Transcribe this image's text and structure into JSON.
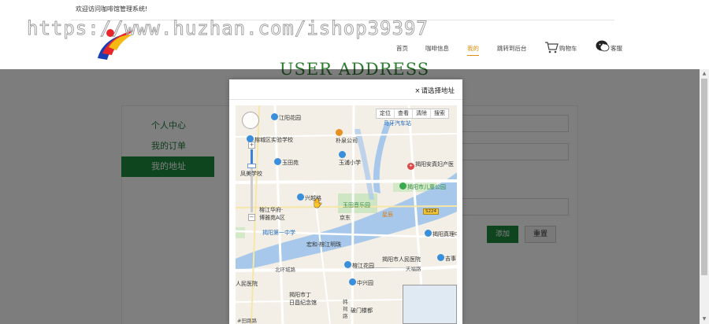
{
  "header": {
    "welcome_text": "欢迎访问咖啡馆管理系统!",
    "watermark": "https://www.huzhan.com/ishop39397",
    "nav": [
      "首页",
      "咖啡信息",
      "我的",
      "跳转到后台",
      "购物车",
      "客服"
    ],
    "active_nav_index": 2
  },
  "page": {
    "heading": "USER ADDRESS",
    "sidebar": [
      "个人中心",
      "我的订单",
      "我的地址"
    ],
    "active_sidebar_index": 2,
    "buttons": {
      "add": "添加",
      "reset": "重置"
    }
  },
  "modal": {
    "close_glyph": "×",
    "title": "请选择地址",
    "toolbar": [
      "定位",
      "查看",
      "清除",
      "搜索"
    ],
    "zoom_plus": "+",
    "zoom_minus": "−",
    "pois": [
      {
        "text": "江阳花园",
        "color": "default"
      },
      {
        "text": "朴泉公司",
        "color": "default"
      },
      {
        "text": "马牙汽车站",
        "color": "blue"
      },
      {
        "text": "榕城区实验学校",
        "color": "default"
      },
      {
        "text": "玉田苑",
        "color": "default"
      },
      {
        "text": "玉浦小学",
        "color": "default"
      },
      {
        "text": "揭阳安真妇产医",
        "color": "default"
      },
      {
        "text": "凤美学校",
        "color": "default"
      },
      {
        "text": "揭阳市儿童公园",
        "color": "green"
      },
      {
        "text": "兴越格",
        "color": "default"
      },
      {
        "text": "玉田音乐园",
        "color": "green"
      },
      {
        "text": "榕江华府·",
        "color": "default"
      },
      {
        "text": "博雅苑A区",
        "color": "default"
      },
      {
        "text": "京东",
        "color": "default"
      },
      {
        "text": "星辰",
        "color": "orange"
      },
      {
        "text": "揭阳第一中学",
        "color": "default"
      },
      {
        "text": "揭阳真理中",
        "color": "default"
      },
      {
        "text": "宏和·榕江明珠",
        "color": "default"
      },
      {
        "text": "揭阳市人民医院",
        "color": "default"
      },
      {
        "text": "吉事",
        "color": "default"
      },
      {
        "text": "榕江花园",
        "color": "default"
      },
      {
        "text": "天福路",
        "color": "default"
      },
      {
        "text": "北环城路",
        "color": "default"
      },
      {
        "text": "人民医院",
        "color": "default"
      },
      {
        "text": "中兴园",
        "color": "default"
      },
      {
        "text": "揭阳市丁",
        "color": "default"
      },
      {
        "text": "日昌纪念馆",
        "color": "default"
      },
      {
        "text": "韩",
        "color": "default"
      },
      {
        "text": "祠",
        "color": "default"
      },
      {
        "text": "路",
        "color": "default"
      },
      {
        "text": "破门楼都",
        "color": "default"
      },
      {
        "text": "S224",
        "color": "default"
      },
      {
        "text": "#田路路",
        "color": "default"
      }
    ]
  },
  "colors": {
    "accent_green": "#1d8a3f",
    "nav_active": "#e58c0a",
    "river": "#a7c8ea"
  }
}
